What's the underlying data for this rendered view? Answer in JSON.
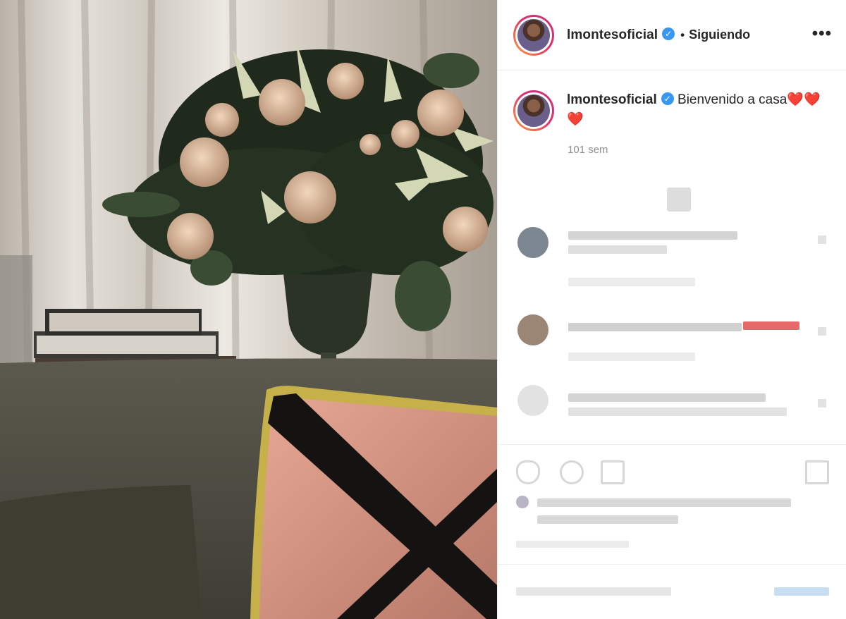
{
  "post": {
    "header": {
      "username": "lmontesoficial",
      "separator": "•",
      "follow_status": "Siguiendo",
      "more_label": "•••"
    },
    "caption": {
      "username": "lmontesoficial",
      "text": "Bienvenido a casa❤️❤️❤️",
      "time": "101 sem"
    }
  },
  "icons": {
    "verified": "verified-badge-icon",
    "more": "more-options-icon",
    "like": "heart-icon",
    "comment": "comment-icon",
    "share": "share-icon",
    "save": "bookmark-icon"
  },
  "colors": {
    "accent_blue": "#3897f0",
    "secondary_text": "#8e8e8e",
    "border": "#efefef"
  }
}
